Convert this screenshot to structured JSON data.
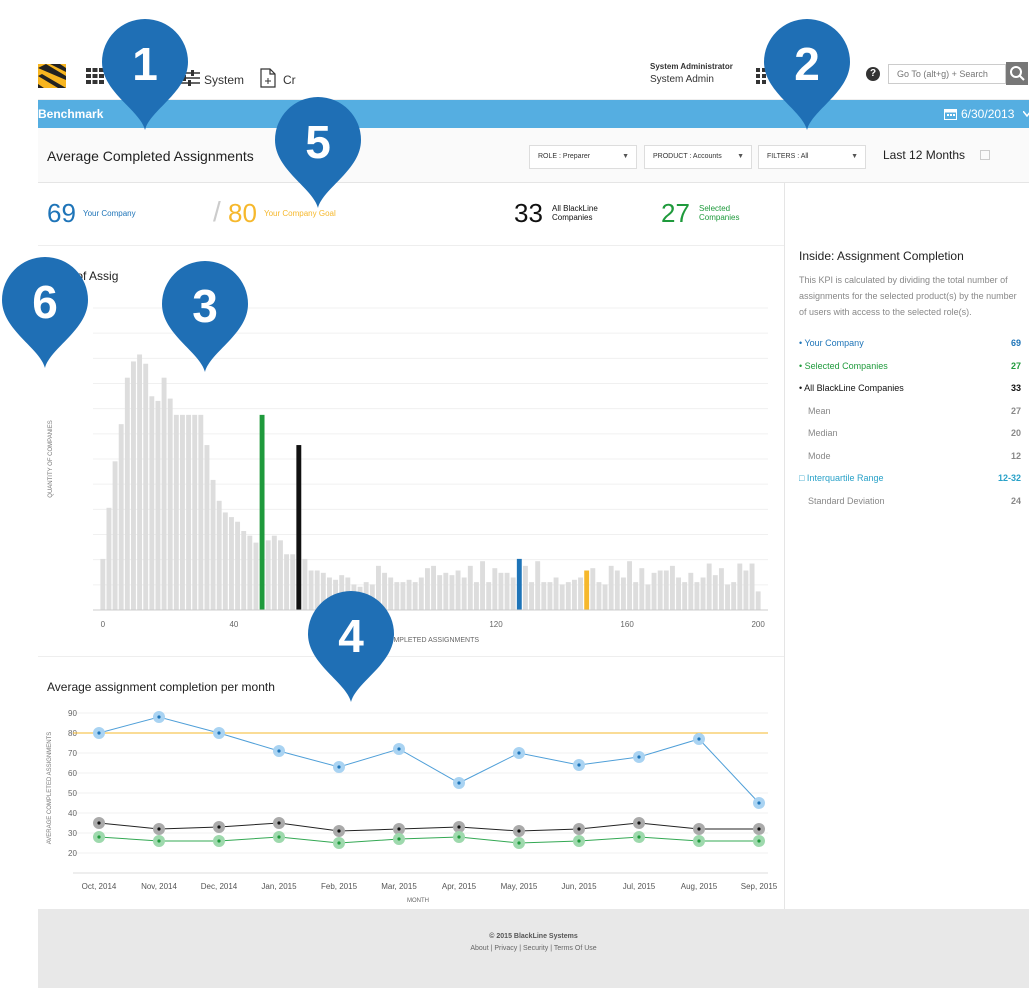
{
  "header": {
    "system_label": "System",
    "create_label": "Cr",
    "user_role": "System Administrator",
    "user_name": "System Admin",
    "help_glyph": "?",
    "search_placeholder": "Go To (alt+g) + Search"
  },
  "bluebar": {
    "title": "Benchmark",
    "date": "6/30/2013"
  },
  "page": {
    "title": "Average Completed Assignments",
    "role_filter": "ROLE : Preparer",
    "product_filter": "PRODUCT : Accounts",
    "filters": "FILTERS : All",
    "period": "Last 12 Months"
  },
  "kpis": {
    "your_company_value": "69",
    "your_company_label": "Your Company",
    "goal_value": "80",
    "goal_label": "Your Company Goal",
    "all_value": "33",
    "all_label_1": "All BlackLine",
    "all_label_2": "Companies",
    "selected_value": "27",
    "selected_label_1": "Selected",
    "selected_label_2": "Companies"
  },
  "section1": {
    "title": "ution of Assig                    etion"
  },
  "section2": {
    "title": "Average assignment completion per month"
  },
  "colors": {
    "blue": "#1e74b8",
    "green": "#1f9a3c",
    "black": "#111111",
    "gold": "#f6b82c",
    "bars": "#dddddd",
    "teal": "#28a1c8"
  },
  "chart_data": [
    {
      "type": "bar",
      "xlabel": "COMPLETED ASSIGNMENTS",
      "ylabel": "QUANTITY OF COMPANIES",
      "xlim": [
        -3,
        203
      ],
      "x_ticks": [
        0,
        40,
        80,
        120,
        160,
        200
      ],
      "x_tick_labels": [
        "0",
        "40",
        "80",
        "120",
        "160",
        "200"
      ],
      "ylim": [
        0,
        130
      ],
      "values": [
        22,
        44,
        64,
        80,
        100,
        107,
        110,
        106,
        92,
        90,
        100,
        91,
        84,
        84,
        84,
        84,
        84,
        71,
        56,
        47,
        42,
        40,
        38,
        34,
        32,
        29,
        29,
        30,
        32,
        30,
        24,
        24,
        21,
        22,
        17,
        17,
        16,
        14,
        13,
        15,
        14,
        11,
        10,
        12,
        11,
        19,
        16,
        14,
        12,
        12,
        13,
        12,
        14,
        18,
        19,
        15,
        16,
        15,
        17,
        14,
        19,
        12,
        21,
        12,
        18,
        16,
        16,
        14,
        16,
        19,
        12,
        21,
        12,
        12,
        14,
        11,
        12,
        13,
        14,
        19,
        18,
        12,
        11,
        19,
        17,
        14,
        21,
        12,
        18,
        11,
        16,
        17,
        17,
        19,
        14,
        12,
        16,
        12,
        14,
        20,
        15,
        18,
        11,
        12,
        20,
        17,
        20,
        8
      ],
      "highlight_bars": [
        {
          "index": 26,
          "value": 84,
          "color": "green"
        },
        {
          "index": 32,
          "value": 71,
          "color": "black"
        },
        {
          "index": 68,
          "value": 22,
          "color": "blue"
        },
        {
          "index": 79,
          "value": 17,
          "color": "gold"
        }
      ]
    },
    {
      "type": "line",
      "xlabel": "MONTH",
      "ylabel": "AVERAGE COMPLETED ASSIGNMENTS",
      "categories": [
        "Oct, 2014",
        "Nov, 2014",
        "Dec, 2014",
        "Jan, 2015",
        "Feb, 2015",
        "Mar, 2015",
        "Apr, 2015",
        "May, 2015",
        "Jun, 2015",
        "Jul, 2015",
        "Aug, 2015",
        "Sep, 2015"
      ],
      "y_ticks": [
        20,
        30,
        40,
        50,
        60,
        70,
        80,
        90
      ],
      "ylim": [
        10,
        95
      ],
      "goal": 80,
      "series": [
        {
          "color": "blue",
          "values": [
            80,
            88,
            80,
            71,
            63,
            72,
            55,
            70,
            64,
            68,
            77,
            45
          ]
        },
        {
          "color": "black",
          "values": [
            35,
            32,
            33,
            35,
            31,
            32,
            33,
            31,
            32,
            35,
            32,
            32
          ]
        },
        {
          "color": "green",
          "values": [
            28,
            26,
            26,
            28,
            25,
            27,
            28,
            25,
            26,
            28,
            26,
            26
          ]
        }
      ]
    }
  ],
  "side": {
    "title": "Inside: Assignment Completion",
    "description": "This KPI is calculated by dividing the total number of assignments for the selected product(s) by the number of users with access to the selected role(s).",
    "stats": [
      {
        "label": "• Your Company",
        "value": "69"
      },
      {
        "label": "• Selected Companies",
        "value": "27"
      },
      {
        "label": "• All BlackLine Companies",
        "value": "33"
      },
      {
        "label": "Mean",
        "value": "27"
      },
      {
        "label": "Median",
        "value": "20"
      },
      {
        "label": "Mode",
        "value": "12"
      },
      {
        "label": "□ Interquartile Range",
        "value": "12-32"
      },
      {
        "label": "Standard Deviation",
        "value": "24"
      }
    ]
  },
  "footer": {
    "copyright": "© 2015 BlackLine Systems",
    "links": "About | Privacy | Security | Terms Of Use"
  },
  "annotations": [
    "1",
    "2",
    "3",
    "4",
    "5",
    "6"
  ]
}
